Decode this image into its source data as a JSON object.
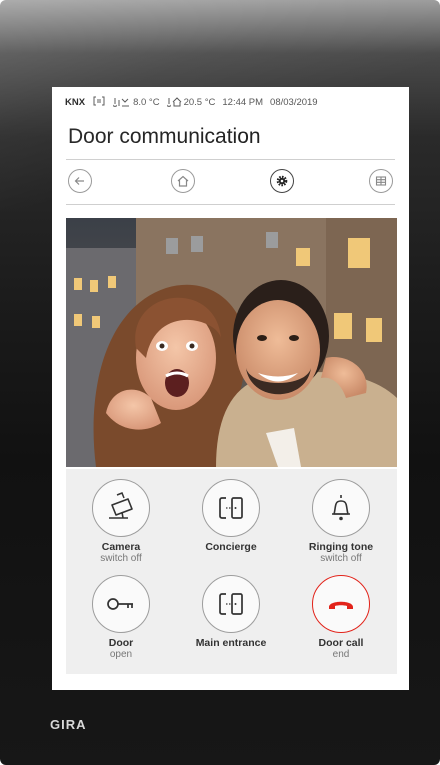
{
  "device": {
    "brand": "GIRA"
  },
  "status_bar": {
    "protocol": "KNX",
    "outdoor_temp": "8.0 °C",
    "indoor_temp": "20.5 °C",
    "time": "12:44 PM",
    "date": "08/03/2019"
  },
  "page": {
    "title": "Door communication"
  },
  "nav": {
    "icons": [
      "back-icon",
      "home-icon",
      "settings-icon",
      "grid-icon"
    ]
  },
  "controls": [
    {
      "label": "Camera",
      "sublabel": "switch off",
      "icon": "camera-icon"
    },
    {
      "label": "Concierge",
      "sublabel": "",
      "icon": "door-station-icon"
    },
    {
      "label": "Ringing tone",
      "sublabel": "switch off",
      "icon": "bell-icon"
    },
    {
      "label": "Door",
      "sublabel": "open",
      "icon": "key-icon"
    },
    {
      "label": "Main entrance",
      "sublabel": "",
      "icon": "door-station-icon"
    },
    {
      "label": "Door call",
      "sublabel": "end",
      "icon": "hang-up-icon",
      "accent": "#e2231a"
    }
  ],
  "colors": {
    "screen_bg": "#ffffff",
    "panel_bg": "#efefef",
    "device_frame": "#1b1b1b",
    "hang_up": "#e2231a"
  }
}
